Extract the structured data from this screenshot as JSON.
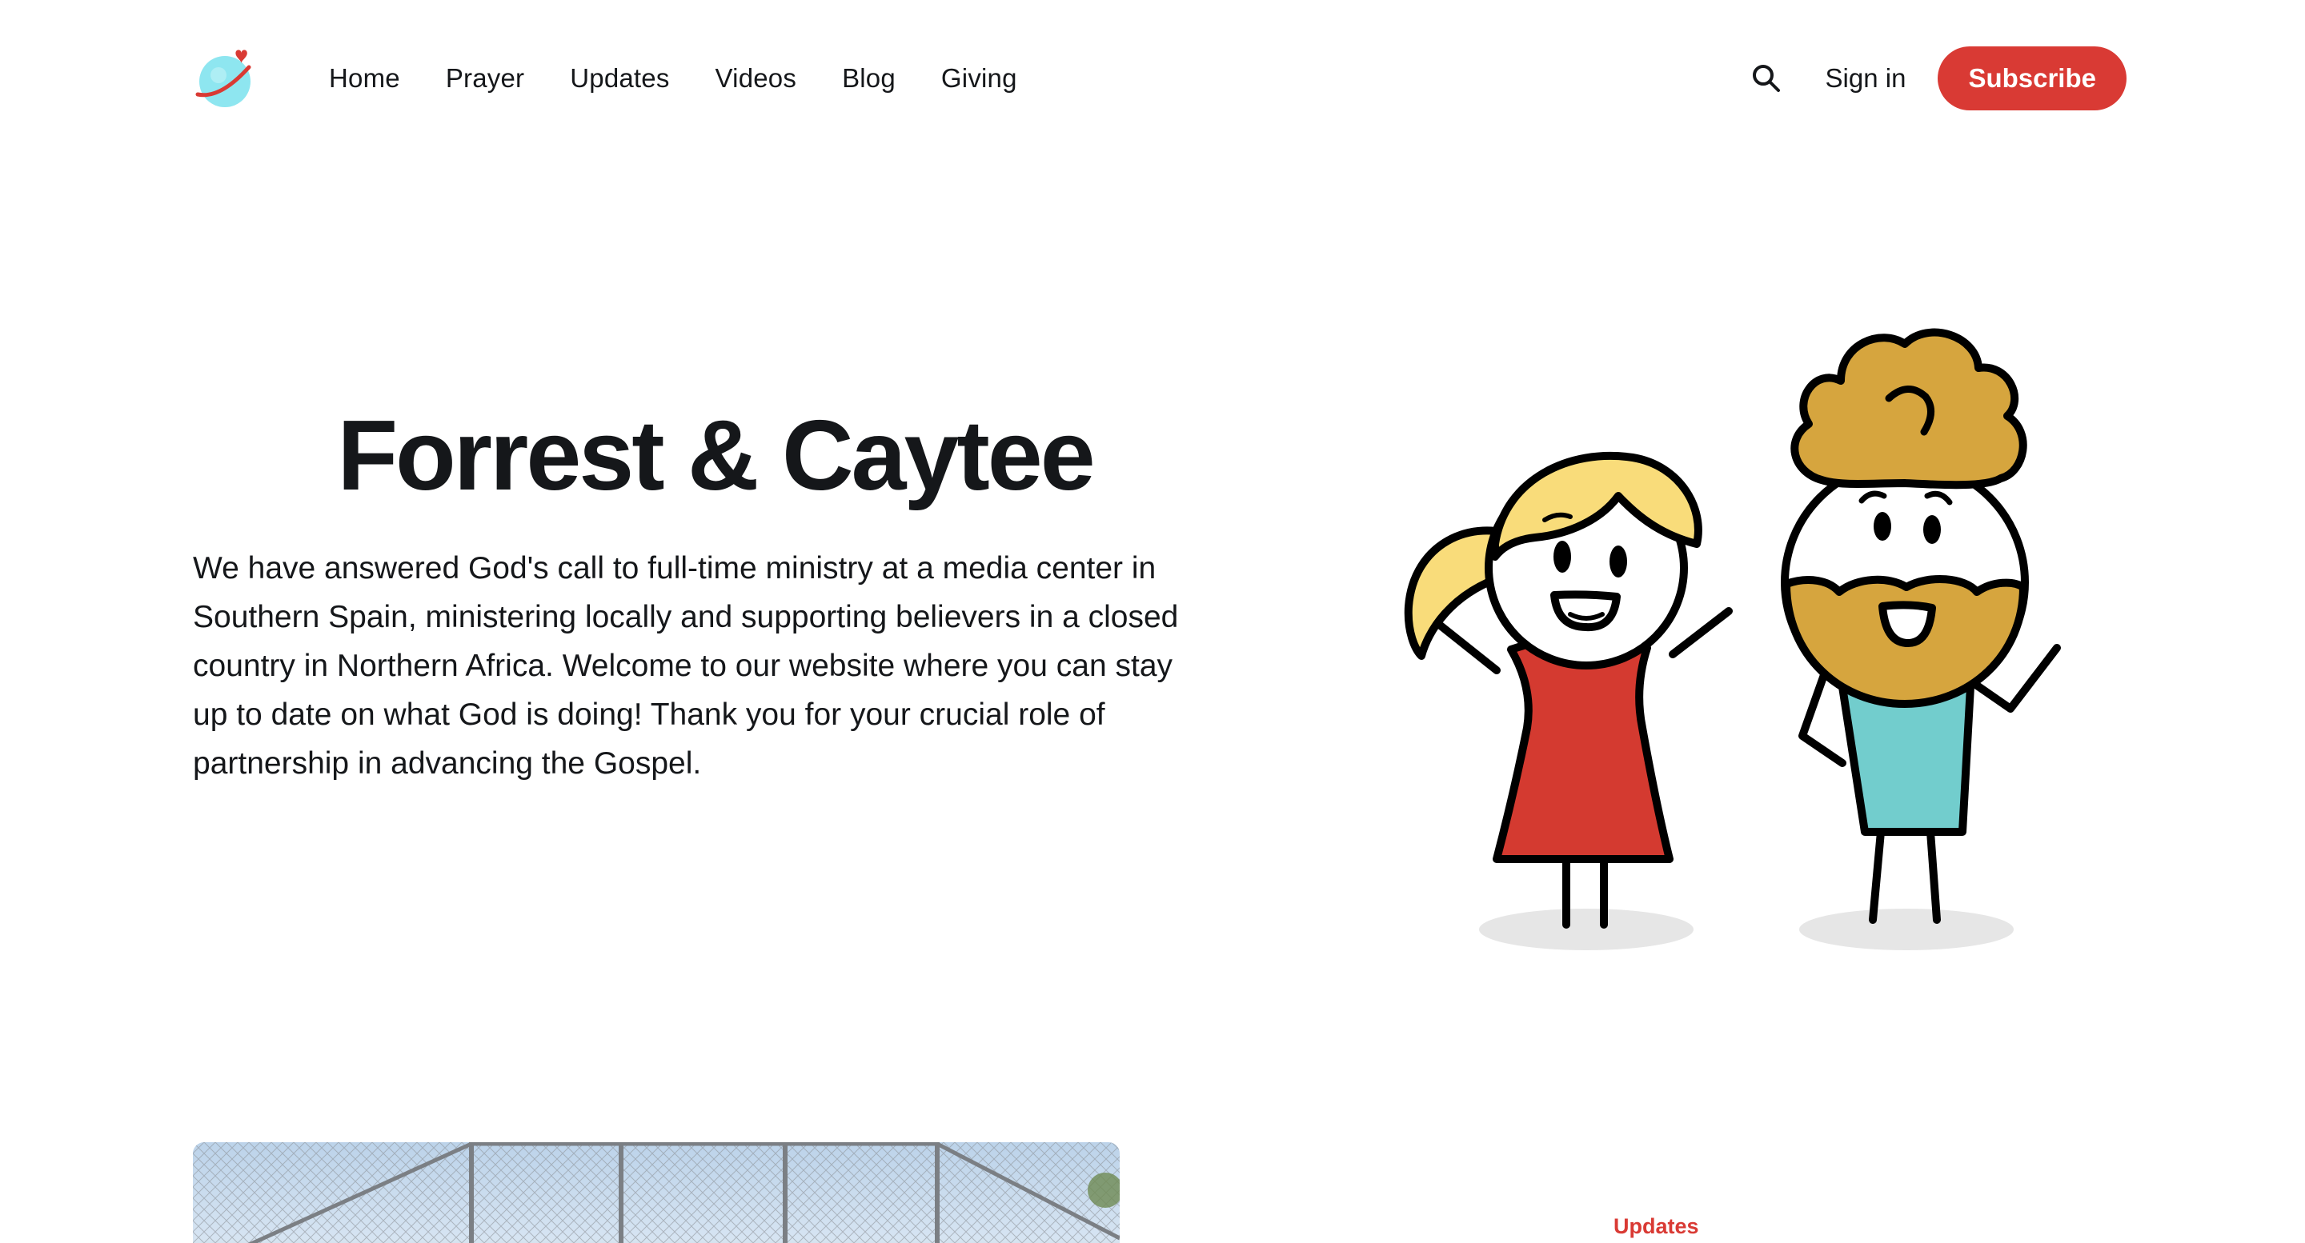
{
  "nav": {
    "items": [
      {
        "label": "Home"
      },
      {
        "label": "Prayer"
      },
      {
        "label": "Updates"
      },
      {
        "label": "Videos"
      },
      {
        "label": "Blog"
      },
      {
        "label": "Giving"
      }
    ],
    "signin_label": "Sign in",
    "subscribe_label": "Subscribe"
  },
  "hero": {
    "title": "Forrest & Caytee",
    "description": "We have answered God's call to full-time ministry at a media center in Southern Spain, ministering locally and supporting believers in a closed country in Northern Africa. Welcome to our website where you can stay up to date on what God is doing! Thank you for your crucial role of partnership in advancing the Gospel."
  },
  "featured": {
    "tag": "Updates"
  },
  "colors": {
    "accent": "#d93a34",
    "logo_blue": "#8ee6f0",
    "dress_red": "#d43a30",
    "shirt_teal": "#72cdcd",
    "hair_blonde": "#f9dc7a",
    "beard_gold": "#d6a53e"
  },
  "icons": {
    "logo": "planet-heart-icon",
    "search": "search-icon"
  }
}
